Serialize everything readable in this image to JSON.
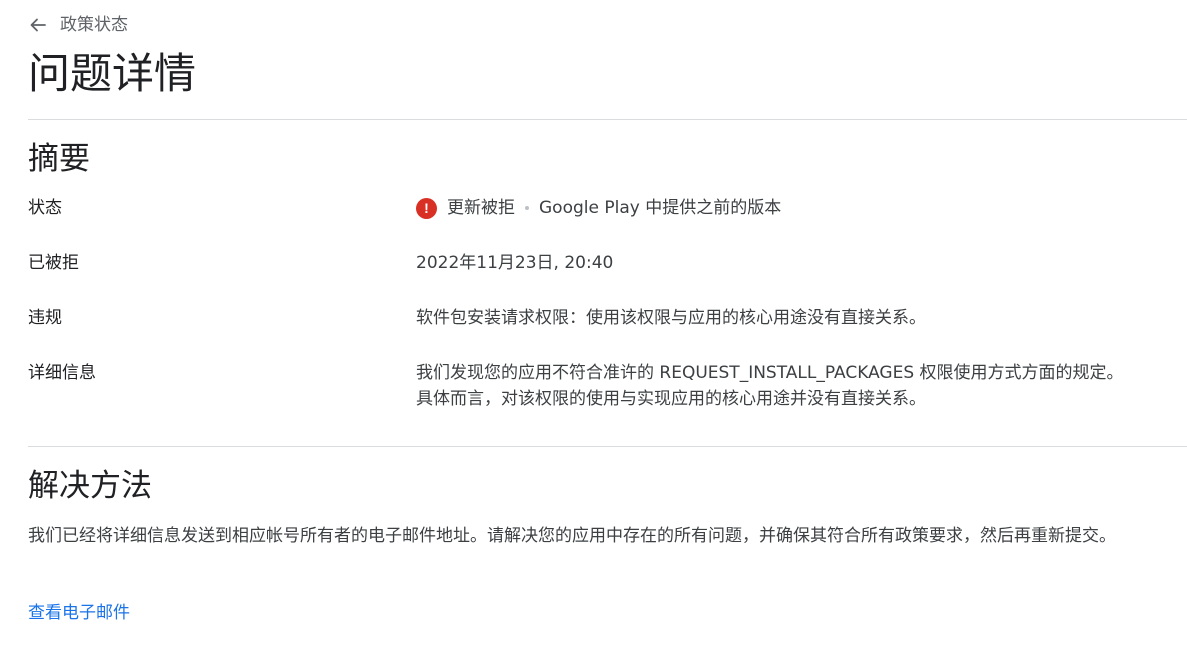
{
  "header": {
    "back_label": "政策状态",
    "title": "问题详情"
  },
  "summary": {
    "title": "摘要",
    "status_label": "状态",
    "status_icon": "error-icon",
    "status_icon_glyph": "!",
    "status_icon_color": "#d93025",
    "status_value": "更新被拒",
    "status_note": "Google Play 中提供之前的版本",
    "rejected_label": "已被拒",
    "rejected_value": "2022年11月23日, 20:40",
    "violation_label": "违规",
    "violation_value": "软件包安装请求权限：使用该权限与应用的核心用途没有直接关系。",
    "details_label": "详细信息",
    "details_line1": "我们发现您的应用不符合准许的 REQUEST_INSTALL_PACKAGES 权限使用方式方面的规定。",
    "details_line2": "具体而言，对该权限的使用与实现应用的核心用途并没有直接关系。"
  },
  "resolution": {
    "title": "解决方法",
    "body": "我们已经将详细信息发送到相应帐号所有者的电子邮件地址。请解决您的应用中存在的所有问题，并确保其符合所有政策要求，然后再重新提交。",
    "link_label": "查看电子邮件",
    "link_color": "#1a73e8"
  }
}
